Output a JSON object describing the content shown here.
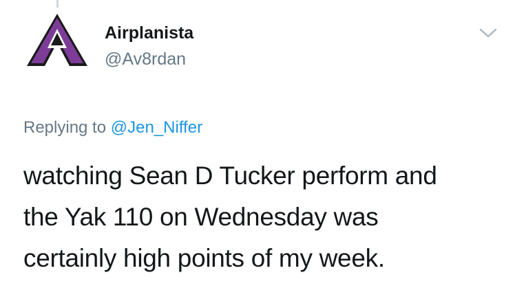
{
  "author": {
    "display_name": "Airplanista",
    "handle": "@Av8rdan",
    "avatar_colors": {
      "outer": "#1a1a1a",
      "fill": "#7d3c98"
    }
  },
  "menu_icon": "chevron-down-icon",
  "reply": {
    "prefix": "Replying to",
    "mention": "@Jen_Niffer"
  },
  "tweet": {
    "lines": [
      "watching Sean D Tucker perform and",
      "the Yak 110 on Wednesday was",
      "certainly high points of my week."
    ]
  },
  "colors": {
    "text_primary": "#14171a",
    "text_secondary": "#657786",
    "link": "#1b95e0",
    "thread_line": "#ccd6dd"
  }
}
